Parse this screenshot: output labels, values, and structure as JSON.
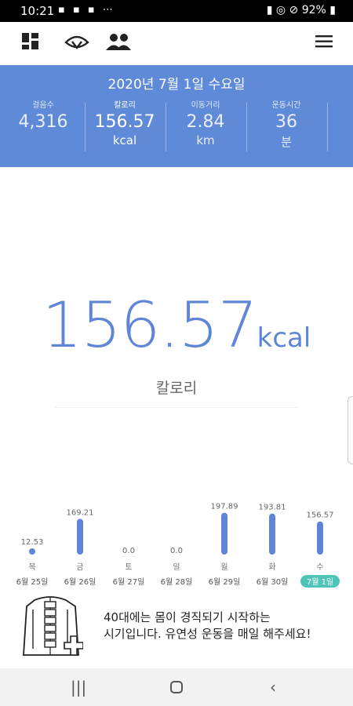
{
  "status_bar": {
    "time": "10:21",
    "battery": "92%"
  },
  "header": {
    "date": "2020년 7월 1일 수요일",
    "stats": [
      {
        "label": "걸음수",
        "value": "4,316",
        "unit": ""
      },
      {
        "label": "칼로리",
        "value": "156.57",
        "unit": "kcal"
      },
      {
        "label": "이동거리",
        "value": "2.84",
        "unit": "km"
      },
      {
        "label": "운동시간",
        "value": "36",
        "unit": "분"
      }
    ]
  },
  "main": {
    "value": "156.57",
    "unit": "kcal",
    "label": "칼로리"
  },
  "chart_data": {
    "type": "bar",
    "categories": [
      "목",
      "금",
      "토",
      "일",
      "월",
      "화",
      "수"
    ],
    "dates": [
      "6월 25일",
      "6월 26일",
      "6월 27일",
      "6월 28일",
      "6월 29일",
      "6월 30일",
      "7월 1일"
    ],
    "values": [
      12.53,
      169.21,
      0.0,
      0.0,
      197.89,
      193.81,
      156.57
    ],
    "value_labels": [
      "12.53",
      "169.21",
      "0.0",
      "0.0",
      "197.89",
      "193.81",
      "156.57"
    ],
    "selected_index": 6,
    "bar_color": "#5f85d6",
    "selected_color": "#4fc4b8"
  },
  "tip": {
    "line1": "40대에는 몸이 경직되기 시작하는",
    "line2": "시기입니다. 유연성 운동을 매일 해주세요!"
  }
}
